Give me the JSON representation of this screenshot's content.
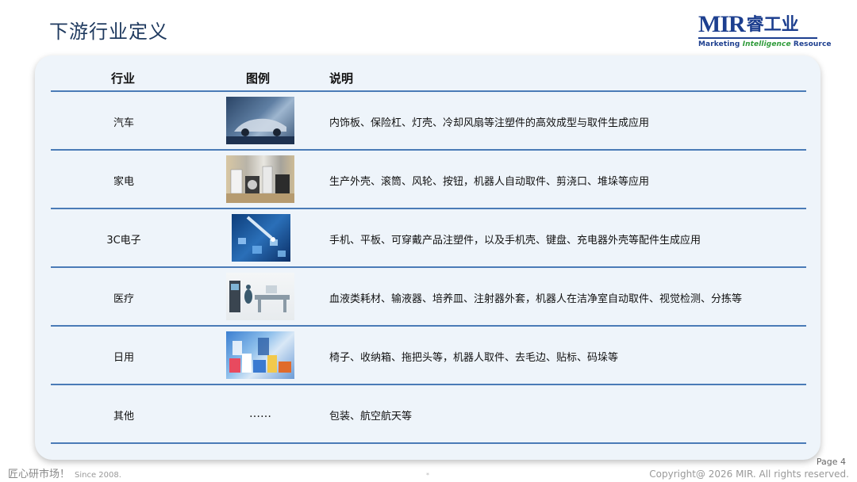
{
  "page": {
    "title": "下游行业定义"
  },
  "logo": {
    "mir": "MIR",
    "cn": "睿工业",
    "sub_1": "Marketing ",
    "sub_2": "Intelligence",
    "sub_3": " Resource"
  },
  "table": {
    "headers": {
      "industry": "行业",
      "image": "图例",
      "description": "说明"
    },
    "rows": [
      {
        "industry": "汽车",
        "image": "car-photo",
        "image_text": "",
        "description": "内饰板、保险杠、灯壳、冷却风扇等注塑件的高效成型与取件生成应用"
      },
      {
        "industry": "家电",
        "image": "appliances-photo",
        "image_text": "",
        "description": "生产外壳、滚筒、风轮、按钮，机器人自动取件、剪浇口、堆垛等应用"
      },
      {
        "industry": "3C电子",
        "image": "electronics-photo",
        "image_text": "",
        "description": "手机、平板、可穿戴产品注塑件，以及手机壳、键盘、充电器外壳等配件生成应用"
      },
      {
        "industry": "医疗",
        "image": "medical-photo",
        "image_text": "",
        "description": "血液类耗材、输液器、培养皿、注射器外套，机器人在洁净室自动取件、视觉检测、分拣等"
      },
      {
        "industry": "日用",
        "image": "daily-goods-photo",
        "image_text": "",
        "description": "椅子、收纳箱、拖把头等，机器人取件、去毛边、贴标、码垛等"
      },
      {
        "industry": "其他",
        "image": "",
        "image_text": "……",
        "description": "包装、航空航天等"
      }
    ]
  },
  "footer": {
    "slogan": "匠心研市场！",
    "since": "Since 2008.",
    "page": "Page 4",
    "copyright": "Copyright@ 2026 MIR. All rights reserved.",
    "mark": "*"
  },
  "colors": {
    "title": "#1f3a5f",
    "brand": "#1d3f8f",
    "accent_green": "#2f9b3a",
    "accent_orange": "#e8a21a",
    "card_bg": "#eef4fa",
    "divider": "#4a7bb7"
  }
}
